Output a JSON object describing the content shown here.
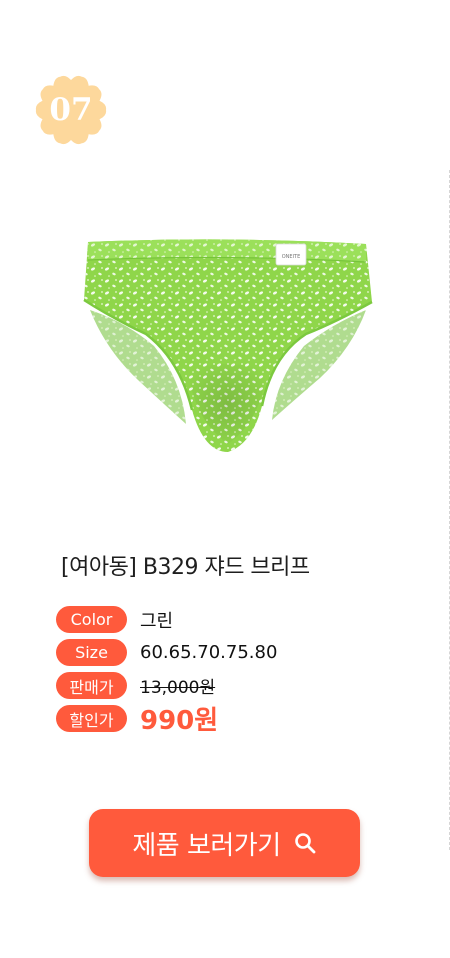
{
  "badge": {
    "number": "07",
    "color": "#fdd89c"
  },
  "product": {
    "title": "[여아동] B329 쟈드 브리프",
    "label_tag": "ONEITE",
    "image": "green-floral-brief",
    "color_accent": "#8fd64a"
  },
  "specs": {
    "color": {
      "label": "Color",
      "value": "그린"
    },
    "size": {
      "label": "Size",
      "value": "60.65.70.75.80"
    },
    "price": {
      "label": "판매가",
      "value": "13,000원"
    },
    "sale": {
      "label": "할인가",
      "value": "990원"
    }
  },
  "cta": {
    "label": "제품 보러가기",
    "icon": "search-icon",
    "color": "#ff5a3c"
  }
}
